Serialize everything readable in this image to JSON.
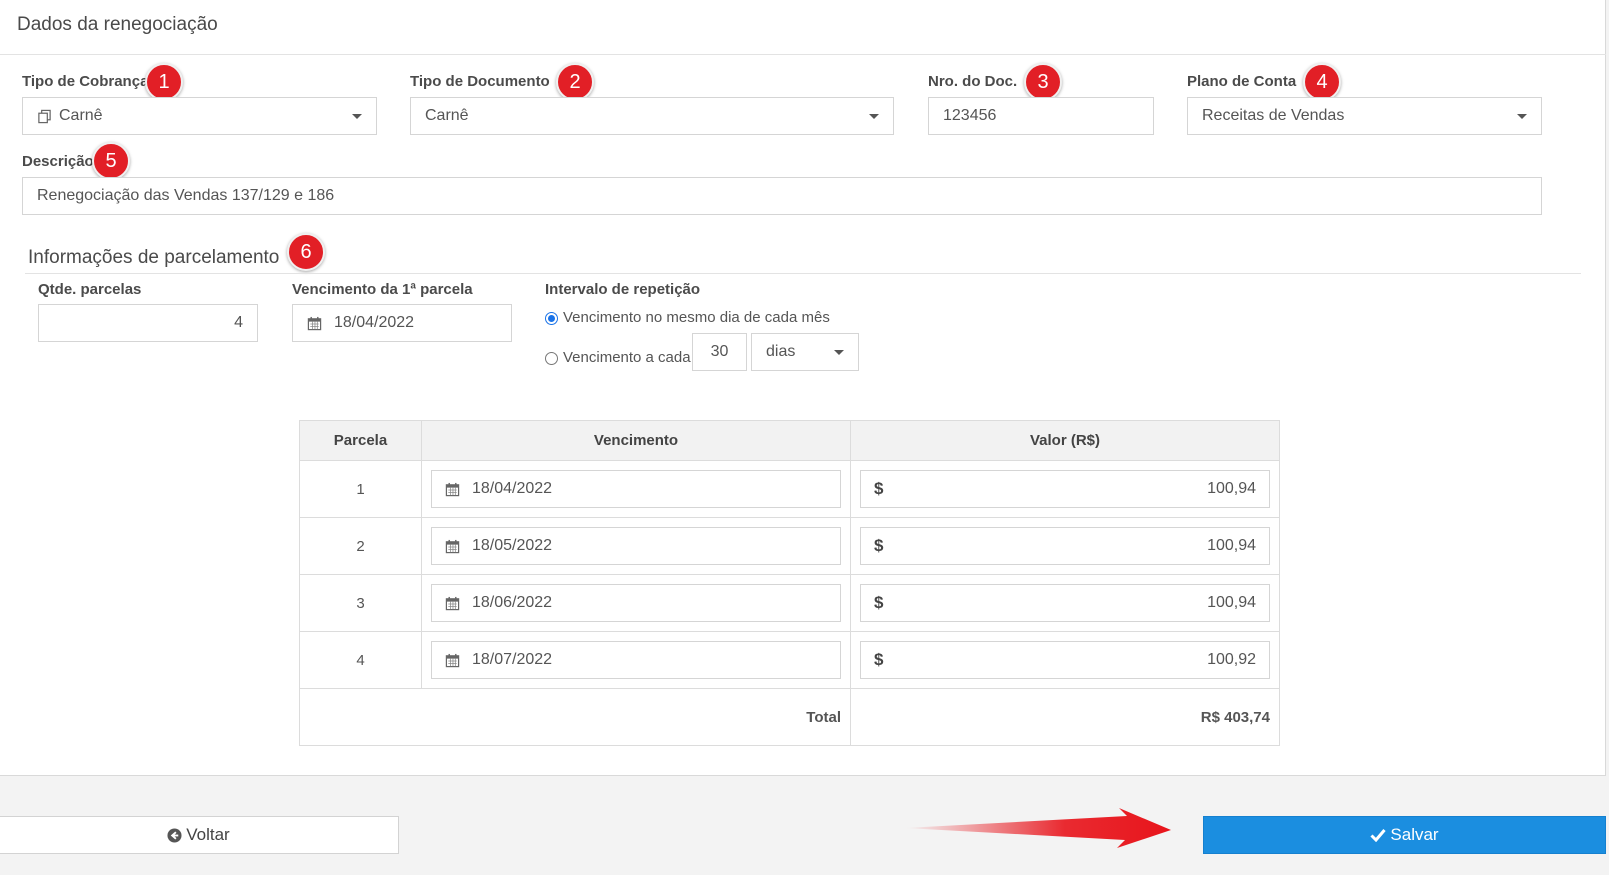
{
  "panel": {
    "title": "Dados da renegociação"
  },
  "fields": {
    "tipo_cobranca": {
      "label": "Tipo de Cobrança",
      "value": "Carnê",
      "badge": "1",
      "icon": "copy-icon"
    },
    "tipo_documento": {
      "label": "Tipo de Documento",
      "value": "Carnê",
      "badge": "2"
    },
    "nro_doc": {
      "label": "Nro. do Doc.",
      "value": "123456",
      "badge": "3"
    },
    "plano_conta": {
      "label": "Plano de Conta",
      "value": "Receitas de Vendas",
      "badge": "4"
    },
    "descricao": {
      "label": "Descrição",
      "value": "Renegociação das Vendas 137/129 e 186",
      "badge": "5"
    }
  },
  "parcelamento": {
    "title": "Informações de parcelamento",
    "badge": "6",
    "qtde_label": "Qtde. parcelas",
    "qtde_value": "4",
    "venc_label": "Vencimento da 1ª parcela",
    "venc_value": "18/04/2022",
    "intervalo_label": "Intervalo de repetição",
    "option_same_day": "Vencimento no mesmo dia de cada mês",
    "option_every": "Vencimento a cada",
    "every_value": "30",
    "every_unit": "dias"
  },
  "table": {
    "headers": [
      "Parcela",
      "Vencimento",
      "Valor (R$)"
    ],
    "currency_symbol": "$",
    "rows": [
      {
        "parcela": "1",
        "vencimento": "18/04/2022",
        "valor": "100,94"
      },
      {
        "parcela": "2",
        "vencimento": "18/05/2022",
        "valor": "100,94"
      },
      {
        "parcela": "3",
        "vencimento": "18/06/2022",
        "valor": "100,94"
      },
      {
        "parcela": "4",
        "vencimento": "18/07/2022",
        "valor": "100,92"
      }
    ],
    "total_label": "Total",
    "total_value": "R$ 403,74"
  },
  "buttons": {
    "back": "Voltar",
    "save": "Salvar"
  },
  "colors": {
    "badge": "#e21f26",
    "primary": "#1b8ee0",
    "arrow": "#e8141b"
  }
}
